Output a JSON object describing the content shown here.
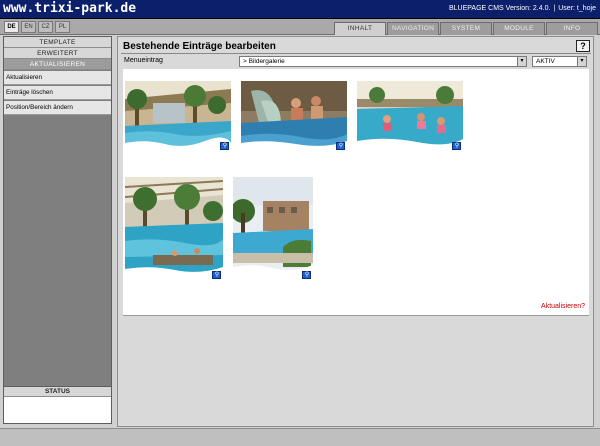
{
  "header": {
    "site_title": "www.trixi-park.de",
    "cms_version": "BLUEPAGE CMS Version: 2.4.0.",
    "separator": "|",
    "user": "User: t_hoje"
  },
  "languages": [
    "DE",
    "EN",
    "CZ",
    "PL"
  ],
  "tabs": [
    {
      "label": "INHALT",
      "active": true
    },
    {
      "label": "NAVIGATION",
      "active": false
    },
    {
      "label": "SYSTEM",
      "active": false
    },
    {
      "label": "MODULE",
      "active": false
    },
    {
      "label": "INFO",
      "active": false
    }
  ],
  "sidebar": {
    "sections": [
      "TEMPLATE",
      "ERWEITERT",
      "AKTUALISIEREN"
    ],
    "items": [
      "Aktualisieren",
      "Einträge löschen",
      "Position/Bereich ändern"
    ],
    "status_label": "STATUS"
  },
  "main": {
    "title": "Bestehende Einträge bearbeiten",
    "help_label": "?",
    "menu_label": "Menueintrag",
    "menu_value": "> Bildergalerie",
    "status_value": "AKTIV",
    "dropdown_arrow": "▾",
    "update_link": "Aktualisieren?"
  },
  "gallery": {
    "count": 5,
    "zoom_icon": "magnifier-icon"
  }
}
